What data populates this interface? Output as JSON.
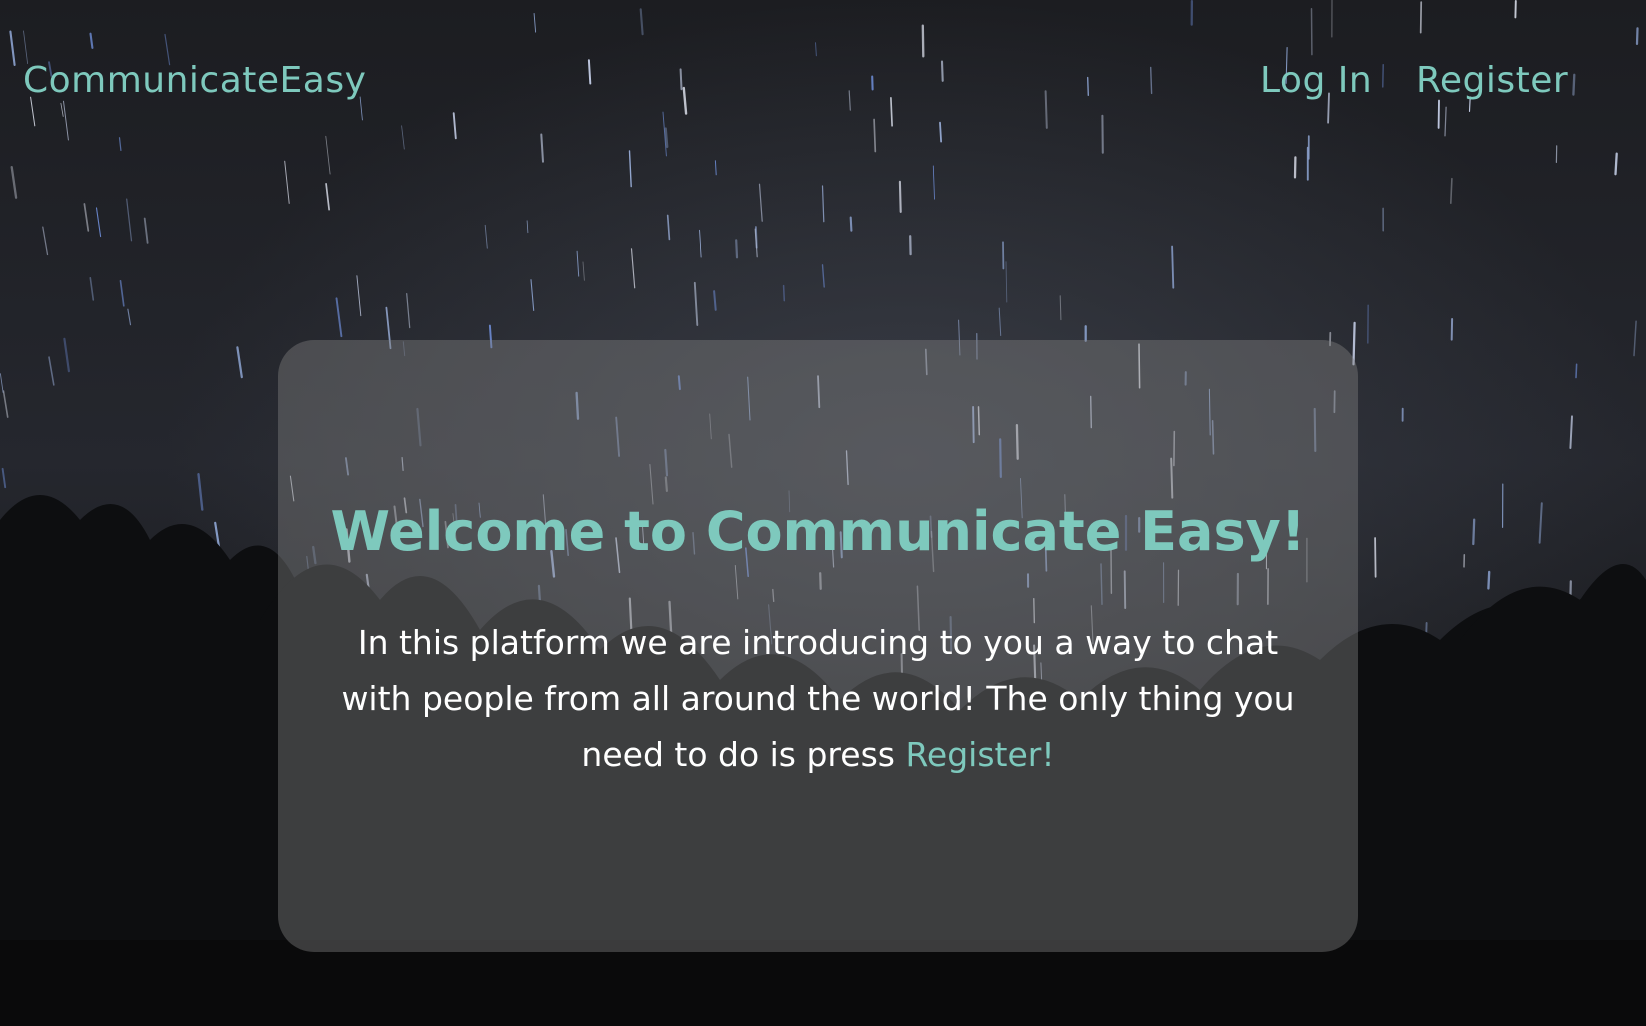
{
  "navbar": {
    "brand": "CommunicateEasy",
    "links": [
      {
        "label": "Log In"
      },
      {
        "label": "Register"
      }
    ]
  },
  "hero": {
    "title": "Welcome to Communicate Easy!",
    "text": "In this platform we are introducing to you a way to chat with people from all around the world! The only thing you need to do is press",
    "cta_label": "Register!"
  },
  "colors": {
    "accent": "#7ec9bd",
    "text": "#ffffff",
    "card": "rgba(128,128,128,0.42)"
  },
  "background": {
    "description_icon": "night-sky-star-trails-with-trees"
  }
}
